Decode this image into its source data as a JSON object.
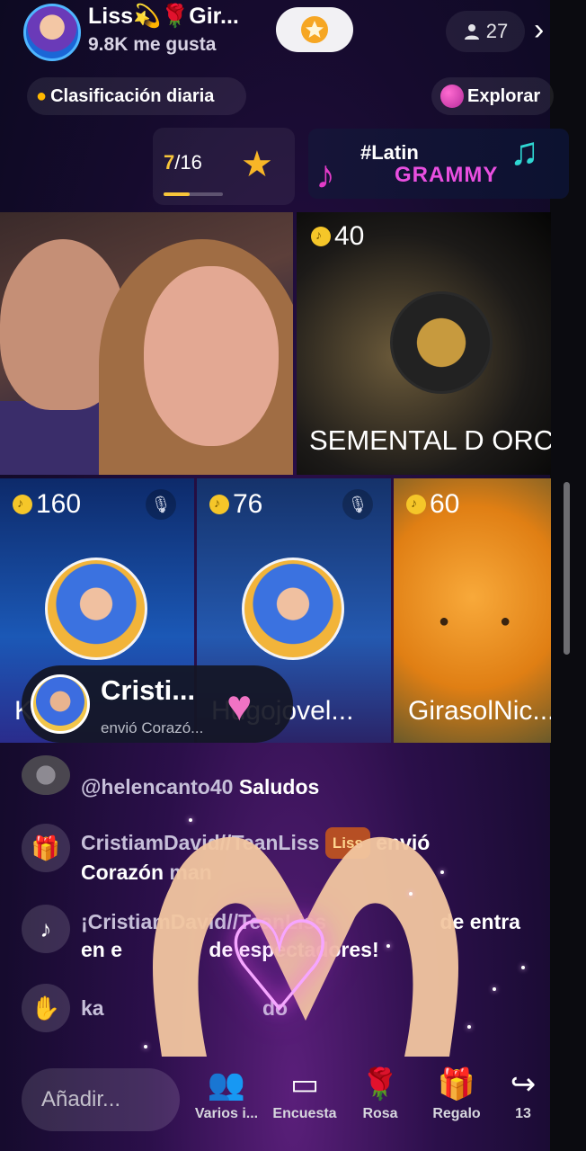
{
  "header": {
    "host_name": "Liss💫🌹Gir...",
    "likes": "9.8K me gusta",
    "viewer_count": "27",
    "follow_icon": "star-badge-icon"
  },
  "chips": {
    "ranking": "Clasificación diaria",
    "explore": "Explorar"
  },
  "ranking_card": {
    "current": "7",
    "total": "/16",
    "progress": 0.44
  },
  "promo": {
    "line1": "#Latin",
    "line2": "GRAMMY"
  },
  "guests": [
    {
      "coins": "40",
      "name": "SEMENTAL D ORO",
      "display": "SEMENTAL D ORC"
    },
    {
      "coins": "160",
      "name": "K"
    },
    {
      "coins": "76",
      "name": "Hugojovel..."
    },
    {
      "coins": "60",
      "name": "GirasolNic..."
    }
  ],
  "gift_notification": {
    "sender": "Cristi...",
    "detail": "envió Corazó..."
  },
  "chat": [
    {
      "user": "@helencanto40",
      "text": "Saludos"
    },
    {
      "user": "CristiamDavid//TeanLiss",
      "badge": "Liss",
      "text": "envió",
      "line2": "Corazón",
      "line2b": "man"
    },
    {
      "user": "¡CristiamDavid//TeanLiss",
      "line1_suffix": "de entra",
      "line2": "en e",
      "line2b": "de espectadores!"
    },
    {
      "user": "ka",
      "text": "do"
    }
  ],
  "bottom_bar": {
    "input_placeholder": "Añadir...",
    "items": [
      {
        "label": "Varios i...",
        "icon": "multi-guest-icon"
      },
      {
        "label": "Encuesta",
        "icon": "poll-icon"
      },
      {
        "label": "Rosa",
        "icon": "rose-icon"
      },
      {
        "label": "Regalo",
        "icon": "gift-icon"
      },
      {
        "label": "13",
        "icon": "share-icon"
      }
    ]
  },
  "colors": {
    "accent_gold": "#f7c53a",
    "brand_pink": "#e94fe0",
    "heart_glow": "#f6a6ff"
  }
}
